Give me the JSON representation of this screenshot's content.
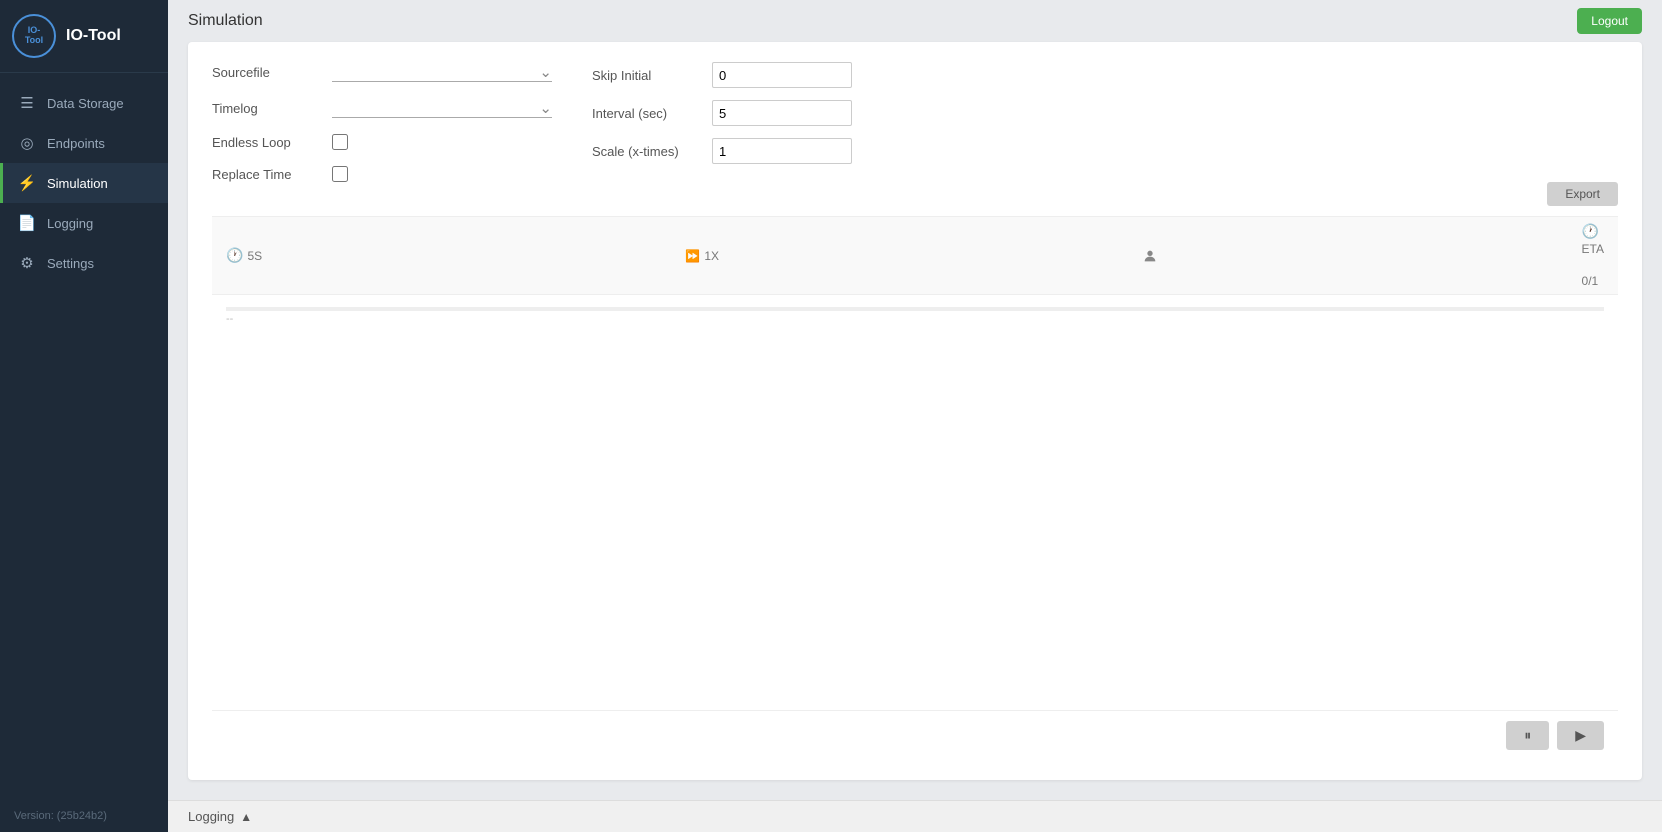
{
  "app": {
    "name": "IO-Tool",
    "logo_lines": [
      "IO-",
      "Tool"
    ],
    "version": "Version: (25b24b2)"
  },
  "sidebar": {
    "items": [
      {
        "id": "data-storage",
        "label": "Data Storage",
        "icon": "☰",
        "active": false
      },
      {
        "id": "endpoints",
        "label": "Endpoints",
        "icon": "◎",
        "active": false
      },
      {
        "id": "simulation",
        "label": "Simulation",
        "icon": "⚡",
        "active": true
      },
      {
        "id": "logging",
        "label": "Logging",
        "icon": "📄",
        "active": false
      },
      {
        "id": "settings",
        "label": "Settings",
        "icon": "⚙",
        "active": false
      }
    ]
  },
  "topbar": {
    "title": "Simulation",
    "logout_label": "Logout"
  },
  "form": {
    "sourcefile_label": "Sourcefile",
    "sourcefile_value": "",
    "timelog_label": "Timelog",
    "timelog_value": "",
    "endless_loop_label": "Endless Loop",
    "endless_loop_checked": false,
    "replace_time_label": "Replace Time",
    "replace_time_checked": false,
    "skip_initial_label": "Skip Initial",
    "skip_initial_value": "0",
    "interval_label": "Interval (sec)",
    "interval_value": "5",
    "scale_label": "Scale (x-times)",
    "scale_value": "1"
  },
  "toolbar": {
    "export_label": "Export"
  },
  "status": {
    "timer_label": "5S",
    "speed_label": "1X",
    "user_icon": "person",
    "eta_label": "ETA",
    "counter_label": "0/1"
  },
  "controls": {
    "pause_label": "⏸",
    "play_label": "▶"
  },
  "logging_bar": {
    "label": "Logging",
    "chevron": "▲"
  },
  "progress": {
    "fill_percent": 0
  },
  "log_line1": "--",
  "log_line2": ""
}
